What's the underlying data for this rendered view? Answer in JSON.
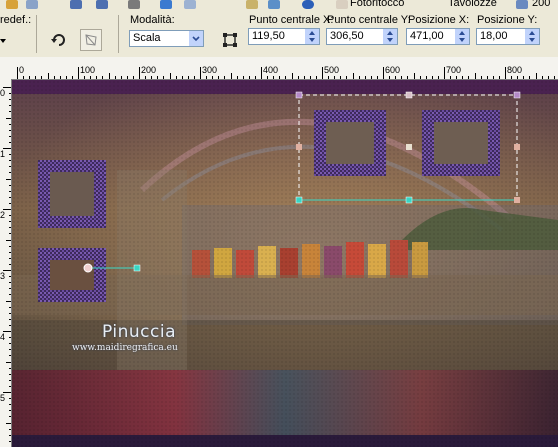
{
  "menubar": {
    "items": [
      "Fotoritocco",
      "Tavolozze"
    ],
    "zoom_value": "200"
  },
  "options": {
    "preset_label": "redef.:",
    "mode_label": "Modalità:",
    "mode_value": "Scala",
    "center_x_label": "Punto centrale X:",
    "center_x_value": "119,50",
    "center_y_label": "Punto centrale Y:",
    "center_y_value": "306,50",
    "pos_x_label": "Posizione X:",
    "pos_x_value": "471,00",
    "pos_y_label": "Posizione Y:",
    "pos_y_value": "18,00"
  },
  "ruler": {
    "h_labels": [
      "0",
      "100",
      "200",
      "300",
      "400",
      "500",
      "600",
      "700",
      "800"
    ],
    "v_labels": [
      "0",
      "1",
      "2",
      "3",
      "4",
      "5"
    ]
  },
  "watermark": {
    "name": "Pinuccia",
    "site": "www.maidiregrafica.eu"
  },
  "colors": {
    "toolbar_bg": "#ece9d8",
    "frame_purple": "#5b3f86",
    "selection_line": "#39d6c4"
  }
}
